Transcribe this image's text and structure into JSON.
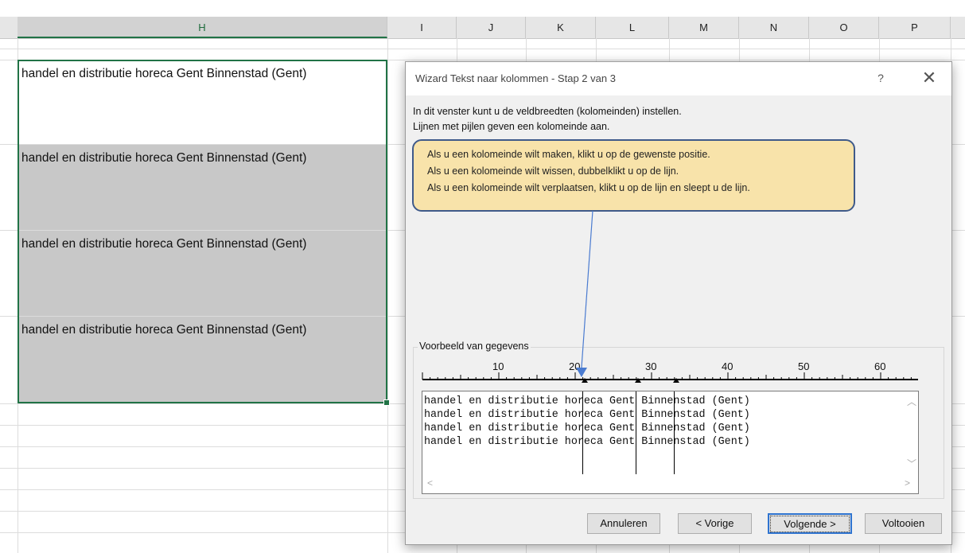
{
  "sheet": {
    "columns": [
      {
        "label": "H",
        "selected": true
      },
      {
        "label": "I"
      },
      {
        "label": "J"
      },
      {
        "label": "K"
      },
      {
        "label": "L"
      },
      {
        "label": "M"
      },
      {
        "label": "N"
      },
      {
        "label": "O"
      },
      {
        "label": "P"
      }
    ],
    "cells": [
      "handel en distributie horeca Gent Binnenstad (Gent)",
      "handel en distributie horeca Gent Binnenstad (Gent)",
      "handel en distributie horeca Gent Binnenstad (Gent)",
      "handel en distributie horeca Gent Binnenstad (Gent)"
    ],
    "selection_color": "#217346",
    "shade_color": "#c8c8c8"
  },
  "dialog": {
    "title": "Wizard Tekst naar kolommen - Stap 2 van 3",
    "help_label": "?",
    "close_label": "✕",
    "instructions": [
      "In dit venster kunt u de veldbreedten (kolomeinden) instellen.",
      "Lijnen met pijlen geven een kolomeinde aan."
    ],
    "tooltip": {
      "lines": [
        "Als u een kolomeinde wilt maken, klikt u op de gewenste positie.",
        "Als u een kolomeinde wilt wissen, dubbelklikt u op de lijn.",
        "Als u een kolomeinde wilt verplaatsen, klikt u op de lijn en sleept u de lijn."
      ],
      "background": "#f8e3aa",
      "border": "#3f5a8a"
    },
    "preview": {
      "legend": "Voorbeeld van gegevens",
      "ruler_numbers": [
        "10",
        "20",
        "30",
        "40",
        "50",
        "60"
      ],
      "lines": [
        "handel en distributie horeca Gent Binnenstad (Gent)",
        "handel en distributie horeca Gent Binnenstad (Gent)",
        "handel en distributie horeca Gent Binnenstad (Gent)",
        "handel en distributie horeca Gent Binnenstad (Gent)"
      ],
      "column_breaks": [
        22,
        29,
        34
      ]
    },
    "buttons": {
      "cancel": "Annuleren",
      "back": "< Vorige",
      "next": "Volgende >",
      "finish": "Voltooien"
    },
    "accent": "#2f74d0"
  }
}
